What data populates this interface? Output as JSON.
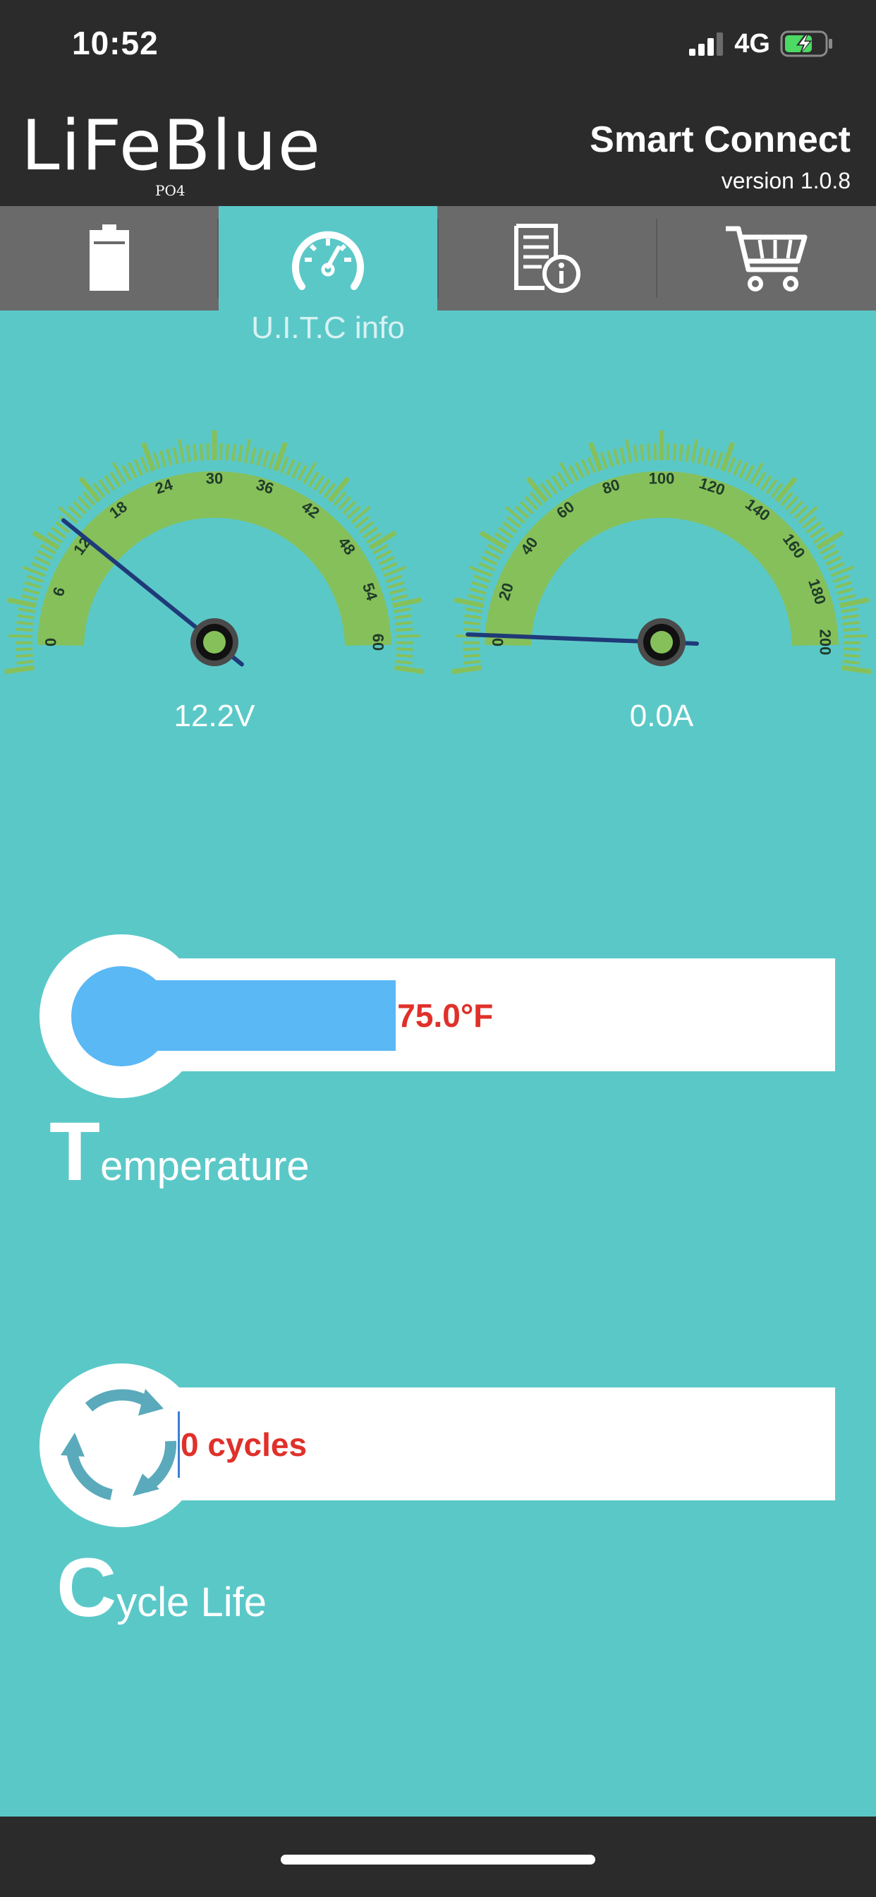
{
  "status_bar": {
    "time": "10:52",
    "network": "4G",
    "signal_icon": "signal-bars-icon",
    "battery_icon": "battery-charging-icon"
  },
  "header": {
    "logo": "LiFeBlue",
    "logo_subscript": "PO4",
    "title": "Smart Connect",
    "version": "version 1.0.8"
  },
  "tabs": [
    {
      "icon": "battery-icon",
      "label": ""
    },
    {
      "icon": "speedometer-icon",
      "label": "U.I.T.C info",
      "active": true
    },
    {
      "icon": "document-info-icon",
      "label": ""
    },
    {
      "icon": "shopping-cart-icon",
      "label": ""
    }
  ],
  "gauges": [
    {
      "name": "voltage",
      "ticks": [
        "0",
        "6",
        "12",
        "18",
        "24",
        "30",
        "36",
        "42",
        "48",
        "54",
        "60"
      ],
      "min": 0,
      "max": 60,
      "value": 12.2,
      "display": "12.2V"
    },
    {
      "name": "current",
      "ticks": [
        "0",
        "20",
        "40",
        "60",
        "80",
        "100",
        "120",
        "140",
        "160",
        "180",
        "200"
      ],
      "min": 0,
      "max": 200,
      "value": 0.0,
      "display": "0.0A"
    }
  ],
  "temperature": {
    "value_text": "75.0°F",
    "fill_fraction": 0.35,
    "label_initial": "T",
    "label_rest": "emperature"
  },
  "cycle_life": {
    "value_text": "0 cycles",
    "label_initial": "C",
    "label_rest": "ycle Life",
    "icon": "cycle-arrows-icon"
  },
  "colors": {
    "background": "#5bc8c8",
    "header": "#2b2b2b",
    "tabbar": "#6a6a6a",
    "gauge_green": "#86c05a",
    "temp_fill": "#5ab8f5",
    "value_red": "#e0302a",
    "needle": "#1f3a78"
  }
}
